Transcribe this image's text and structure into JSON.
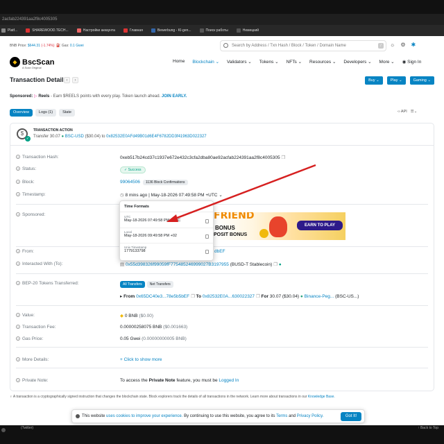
{
  "browser": {
    "url": "2acfab224391aa2f8c4005305",
    "bookmarks": [
      {
        "label": "Platf...",
        "color": "#888"
      },
      {
        "label": "SHAREWOOD.TECH...",
        "color": "#d33"
      },
      {
        "label": "Настройки аккаунта",
        "color": "#e66"
      },
      {
        "label": "Главная",
        "color": "#d33"
      },
      {
        "label": "Bewerbung - KI-gen...",
        "color": "#36a"
      },
      {
        "label": "Поиск работы",
        "color": "#555"
      },
      {
        "label": "Немецкий",
        "color": "#555"
      }
    ]
  },
  "status": {
    "bnb_label": "BNB Price:",
    "bnb_value": "$644.31",
    "bnb_change": "(-1.74%)",
    "gas_label": "Gas:",
    "gas_value": "0.1 Gwei"
  },
  "search": {
    "placeholder": "Search by Address / Txn Hash / Block / Token / Domain Name",
    "shortcut": "/"
  },
  "nav": {
    "logo": "BscScan",
    "logo_sub": "A Scan Original",
    "items": [
      "Home",
      "Blockchain",
      "Validators",
      "Tokens",
      "NFTs",
      "Resources",
      "Developers",
      "More",
      "Sign In"
    ]
  },
  "header": {
    "title": "Transaction Details",
    "prev": "‹",
    "next": "›",
    "buttons": [
      "Buy",
      "Play",
      "Gaming"
    ]
  },
  "sponsored": {
    "label": "Sponsored:",
    "brand": "Reels",
    "text": " - Earn $REELS points with every play. Token launch ahead.",
    "cta": "JOIN EARLY."
  },
  "tabs": [
    "Overview",
    "Logs (1)",
    "State"
  ],
  "api": "API",
  "action": {
    "title": "TRANSACTION ACTION",
    "prefix": "Transfer",
    "amount": "30.07",
    "token": "BSC-USD",
    "usd": "($30.04) to",
    "to": "0x82532E0AFd49B01d6E4F6782DD3f41963D022327"
  },
  "rows": {
    "hash_label": "Transaction Hash:",
    "hash": "0xeb517b24cd37c1937e672e432c3cfa2dba80ae92acfab224391aa2f8c4005305",
    "status_label": "Status:",
    "status": "Success",
    "block_label": "Block:",
    "block": "99064506",
    "confirmations": "1136 Block Confirmations",
    "timestamp_label": "Timestamp:",
    "timestamp": "8 mins ago | May-18-2026 07:49:58 PM +UTC",
    "sponsored_label": "Sponsored:",
    "from_label": "From:",
    "from_tail": "dbEF",
    "interacted_label": "Interacted With (To):",
    "interacted": "0x55d398326f99059fF775485246999027B3197955",
    "interacted_name": "(BUSD-T Stablecoin)",
    "bep20_label": "BEP-20 Tokens Transferred:",
    "bep20_tabs": [
      "All Transfers",
      "Net Transfers"
    ],
    "transfer": {
      "from_label": "From",
      "from": "0x65DC40e3...78e5b5bEF",
      "to_label": "To",
      "to": "0x82532E0A...630022327",
      "for_label": "For",
      "amount": "30.07",
      "usd": "($30.04)",
      "token": "Binance-Peg...",
      "token_sym": "(BSC-US...)"
    },
    "value_label": "Value:",
    "value": "0 BNB",
    "value_usd": "($0.00)",
    "fee_label": "Transaction Fee:",
    "fee": "0.00000258075 BNB",
    "fee_usd": "($0.001663)",
    "gas_label": "Gas Price:",
    "gas": "0.05 Gwei",
    "gas_bnb": "(0.00000000005 BNB)",
    "more_label": "More Details:",
    "more": "+ Click to show more",
    "note_label": "Private Note:",
    "note_pre": "To access the",
    "note_bold": "Private Note",
    "note_mid": "feature, you must be",
    "note_link": "Logged In"
  },
  "popup": {
    "title": "Time Formats",
    "utc_label": "UTC",
    "utc": "May-18-2026 07:49:58 PM +UTC",
    "local_label": "Local",
    "local": "May-18-2026 09:49:58 PM +02",
    "unix_label": "Unix Timestamp",
    "unix": "1779133798"
  },
  "ad": {
    "line1": "FRIEND",
    "line2": "BONUS",
    "line3": "POSIT BONUS",
    "cta": "EARN TO PLAY"
  },
  "footnote": {
    "text": "A transaction is a cryptographically signed instruction that changes the blockchain state. Block explorers track the details of all transactions in the network. Learn more about transactions in our",
    "link": "Knowledge Base."
  },
  "cookie": {
    "pre": "This website",
    "link1": "uses cookies to improve your experience.",
    "mid": "By continuing to use this website, you agree to its",
    "link2": "Terms",
    "and": "and",
    "link3": "Privacy Policy.",
    "button": "Got It!"
  },
  "bottom": {
    "left": "(Twitter)",
    "right": "Back to Top"
  },
  "colors": {
    "accent": "#0784c3",
    "success": "#00a186",
    "arrow": "#d62020"
  }
}
